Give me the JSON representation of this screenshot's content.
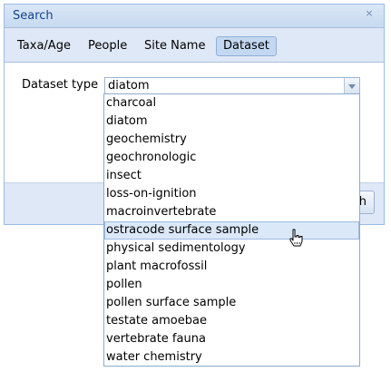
{
  "dialog": {
    "title": "Search",
    "close_icon": "×"
  },
  "tabs": [
    {
      "label": "Taxa/Age",
      "active": false
    },
    {
      "label": "People",
      "active": false
    },
    {
      "label": "Site Name",
      "active": false
    },
    {
      "label": "Dataset",
      "active": true
    }
  ],
  "form": {
    "dataset_type_label": "Dataset type",
    "dataset_type_value": "diatom"
  },
  "footer": {
    "search_button_label": "Search"
  },
  "dropdown": {
    "options": [
      "charcoal",
      "diatom",
      "geochemistry",
      "geochronologic",
      "insect",
      "loss-on-ignition",
      "macroinvertebrate",
      "ostracode surface sample",
      "physical sedimentology",
      "plant macrofossil",
      "pollen",
      "pollen surface sample",
      "testate amoebae",
      "vertebrate fauna",
      "water chemistry"
    ],
    "hovered": "ostracode surface sample"
  },
  "colors": {
    "accent": "#15428b",
    "hover": "#dbe8f8"
  },
  "icons": {
    "close": "close-icon",
    "trigger": "chevron-down-icon",
    "cursor": "hand-pointer-icon"
  }
}
